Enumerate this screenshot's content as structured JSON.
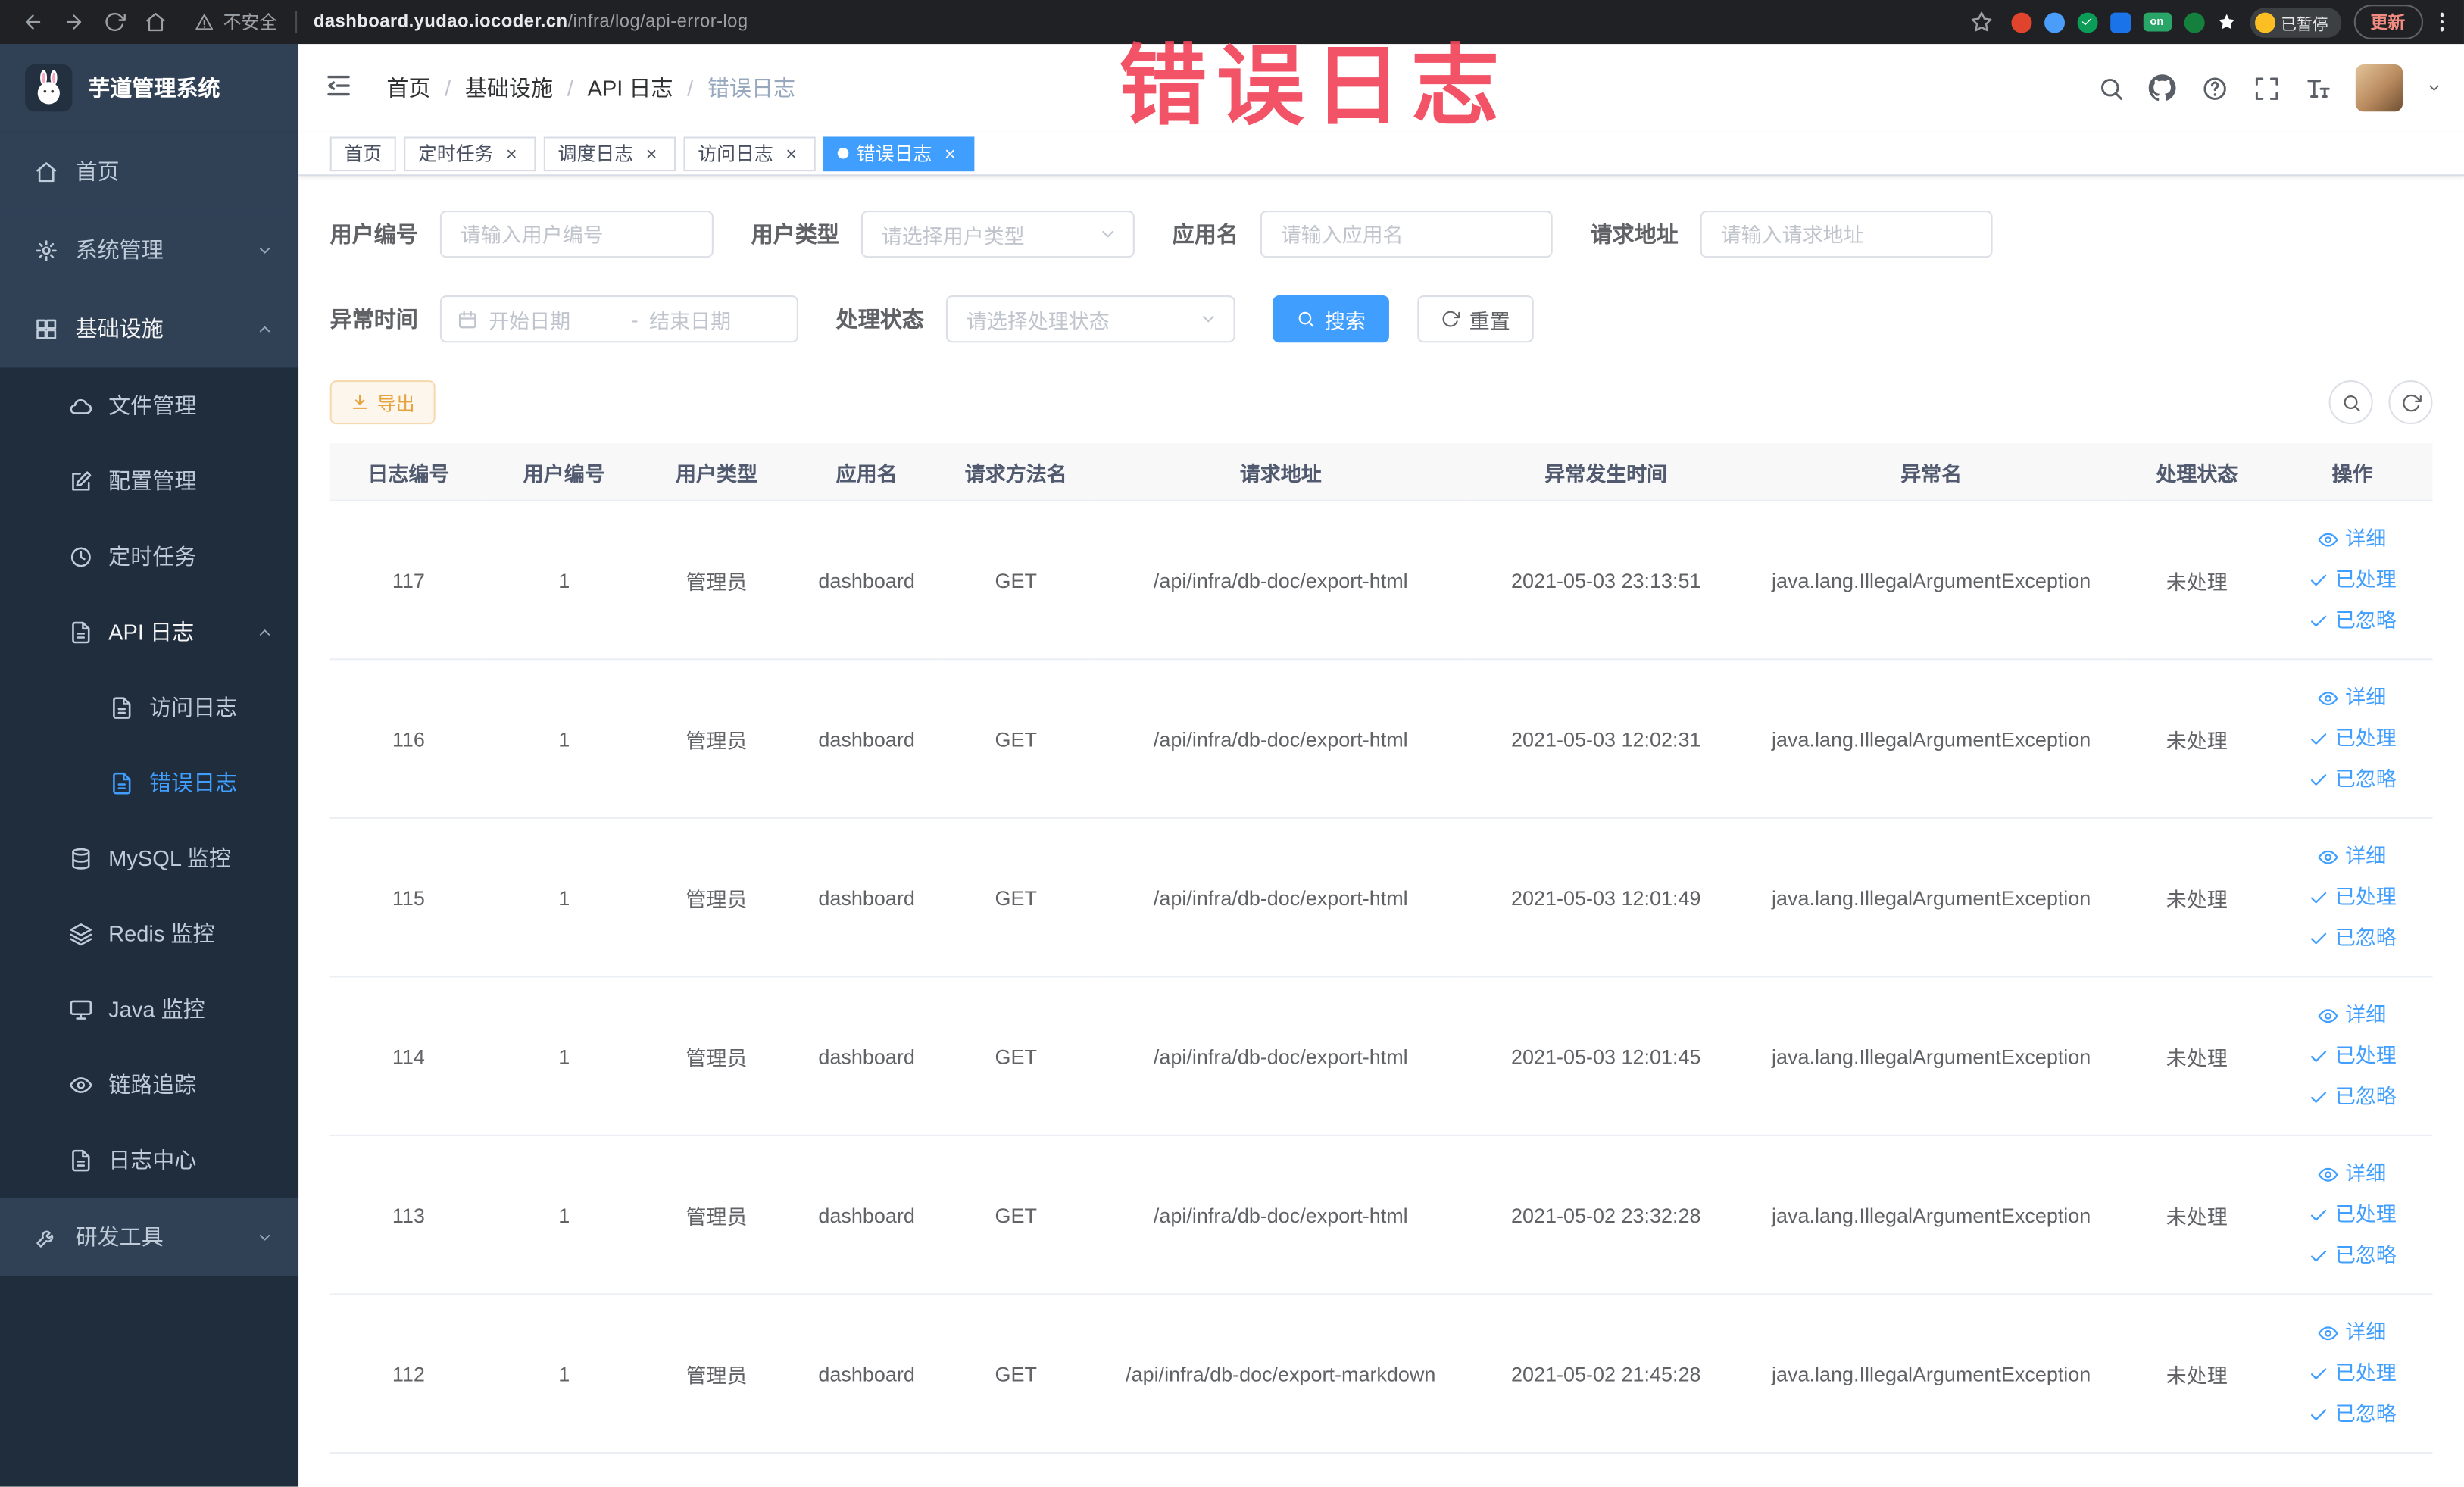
{
  "browser": {
    "security_label": "不安全",
    "url_domain": "dashboard.yudao.iocoder.cn",
    "url_path": "/infra/log/api-error-log",
    "on_badge": "on",
    "paused_badge": "已暂停",
    "update_button": "更新"
  },
  "annotation": {
    "text": "错误日志"
  },
  "sidebar": {
    "logo_title": "芋道管理系统",
    "items": {
      "home": "首页",
      "system_mgmt": "系统管理",
      "infrastructure": "基础设施",
      "file_mgmt": "文件管理",
      "config_mgmt": "配置管理",
      "cron_job": "定时任务",
      "api_log": "API 日志",
      "access_log": "访问日志",
      "error_log": "错误日志",
      "mysql_monitor": "MySQL 监控",
      "redis_monitor": "Redis 监控",
      "java_monitor": "Java 监控",
      "trace": "链路追踪",
      "log_center": "日志中心",
      "dev_tools": "研发工具"
    }
  },
  "breadcrumb": {
    "home": "首页",
    "infrastructure": "基础设施",
    "api_log": "API 日志",
    "current": "错误日志",
    "separator": "/"
  },
  "tabs": {
    "home": "首页",
    "cron_job": "定时任务",
    "schedule_log": "调度日志",
    "access_log": "访问日志",
    "error_log": "错误日志"
  },
  "filters": {
    "user_id": {
      "label": "用户编号",
      "placeholder": "请输入用户编号"
    },
    "user_type": {
      "label": "用户类型",
      "placeholder": "请选择用户类型"
    },
    "app_name": {
      "label": "应用名",
      "placeholder": "请输入应用名"
    },
    "request_url": {
      "label": "请求地址",
      "placeholder": "请输入请求地址"
    },
    "exception_time": {
      "label": "异常时间",
      "start_placeholder": "开始日期",
      "range_separator": "-",
      "end_placeholder": "结束日期"
    },
    "process_status": {
      "label": "处理状态",
      "placeholder": "请选择处理状态"
    },
    "search_button": "搜索",
    "reset_button": "重置"
  },
  "toolbar": {
    "export_button": "导出"
  },
  "table": {
    "columns": [
      "日志编号",
      "用户编号",
      "用户类型",
      "应用名",
      "请求方法名",
      "请求地址",
      "异常发生时间",
      "异常名",
      "处理状态",
      "操作"
    ],
    "row_actions": {
      "detail": "详细",
      "processed": "已处理",
      "ignored": "已忽略"
    },
    "rows": [
      {
        "id": "117",
        "user_id": "1",
        "user_type": "管理员",
        "app_name": "dashboard",
        "method": "GET",
        "url": "/api/infra/db-doc/export-html",
        "time": "2021-05-03 23:13:51",
        "exception": "java.lang.IllegalArgumentException",
        "status": "未处理"
      },
      {
        "id": "116",
        "user_id": "1",
        "user_type": "管理员",
        "app_name": "dashboard",
        "method": "GET",
        "url": "/api/infra/db-doc/export-html",
        "time": "2021-05-03 12:02:31",
        "exception": "java.lang.IllegalArgumentException",
        "status": "未处理"
      },
      {
        "id": "115",
        "user_id": "1",
        "user_type": "管理员",
        "app_name": "dashboard",
        "method": "GET",
        "url": "/api/infra/db-doc/export-html",
        "time": "2021-05-03 12:01:49",
        "exception": "java.lang.IllegalArgumentException",
        "status": "未处理"
      },
      {
        "id": "114",
        "user_id": "1",
        "user_type": "管理员",
        "app_name": "dashboard",
        "method": "GET",
        "url": "/api/infra/db-doc/export-html",
        "time": "2021-05-03 12:01:45",
        "exception": "java.lang.IllegalArgumentException",
        "status": "未处理"
      },
      {
        "id": "113",
        "user_id": "1",
        "user_type": "管理员",
        "app_name": "dashboard",
        "method": "GET",
        "url": "/api/infra/db-doc/export-html",
        "time": "2021-05-02 23:32:28",
        "exception": "java.lang.IllegalArgumentException",
        "status": "未处理"
      },
      {
        "id": "112",
        "user_id": "1",
        "user_type": "管理员",
        "app_name": "dashboard",
        "method": "GET",
        "url": "/api/infra/db-doc/export-markdown",
        "time": "2021-05-02 21:45:28",
        "exception": "java.lang.IllegalArgumentException",
        "status": "未处理"
      }
    ]
  },
  "colors": {
    "primary": "#409eff",
    "warning": "#e6a23c",
    "annotation_red": "#f2455a",
    "sidebar_bg": "#304156",
    "sidebar_submenu_bg": "#1f2d3d",
    "chrome_bg": "#202124"
  }
}
